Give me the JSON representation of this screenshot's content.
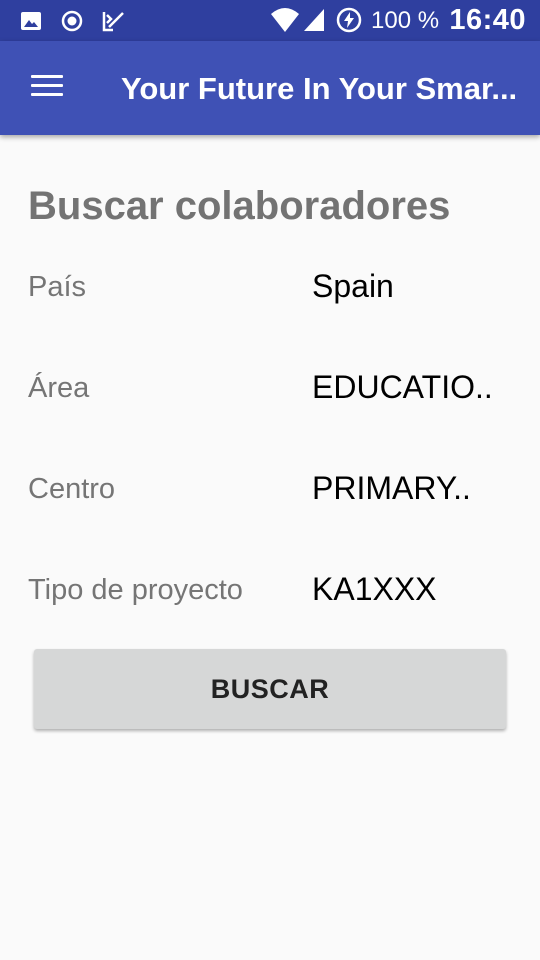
{
  "status_bar": {
    "icons_left": [
      "image-icon",
      "record-icon",
      "checklist-icon"
    ],
    "icons_right": [
      "wifi-icon",
      "cell-signal-icon",
      "battery-saver-icon"
    ],
    "battery": "100 %",
    "time": "16:40"
  },
  "app_bar": {
    "title": "Your Future In Your Smar...",
    "menu_icon": "hamburger-menu-icon",
    "color": "#3f51b5"
  },
  "main": {
    "heading": "Buscar colaboradores",
    "fields": [
      {
        "label": "País",
        "value": "Spain"
      },
      {
        "label": "Área",
        "value": "EDUCATIO.."
      },
      {
        "label": "Centro",
        "value": "PRIMARY.."
      },
      {
        "label": "Tipo de proyecto",
        "value": "KA1XXX"
      }
    ],
    "search_button": "BUSCAR"
  },
  "colors": {
    "status_bar": "#2f3f9f",
    "app_bar": "#3f51b5",
    "background": "#fafafa",
    "button": "#d6d7d7"
  }
}
